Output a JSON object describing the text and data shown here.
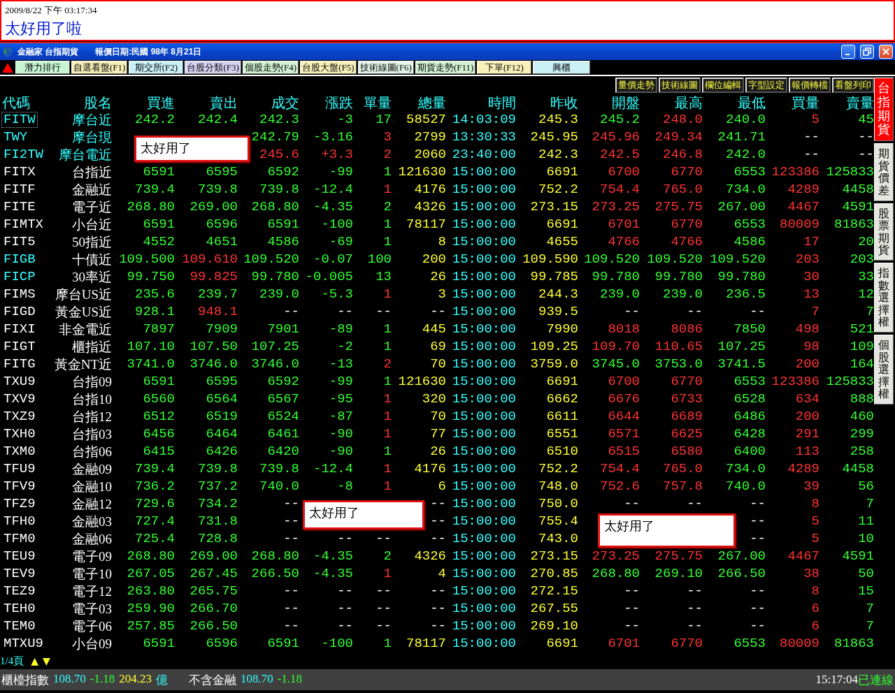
{
  "banner": {
    "timestamp": "2009/8/22 下午 03:17:34",
    "message": "太好用了啦"
  },
  "window": {
    "app_name": "金融家 台指期貨",
    "quote_date": "報價日期:民國 98年 8月21日"
  },
  "function_tabs": [
    {
      "label": "潛力排行",
      "color": "#c8f5d2"
    },
    {
      "label": "自選看盤(F1)",
      "color": "#f7f0b8"
    },
    {
      "label": "期交所(F2)",
      "color": "#c8f0f5"
    },
    {
      "label": "台股分類(F3)",
      "color": "#d8d2f2"
    },
    {
      "label": "個股走勢(F4)",
      "color": "#d2f2d2"
    },
    {
      "label": "台股大盤(F5)",
      "color": "#f7f0b8"
    },
    {
      "label": "技術線圖(F6)",
      "color": "#e2f5ea"
    },
    {
      "label": "期貨走勢(F11)",
      "color": "#d2f2d2"
    },
    {
      "label": "下單(F12)",
      "color": "#f7f0b8"
    },
    {
      "label": "興櫃",
      "color": "#c8f0f5"
    }
  ],
  "toolbar": [
    "量價走勢",
    "技術線圖",
    "欄位編輯",
    "字型設定",
    "報價轉檔",
    "看盤列印"
  ],
  "side_tabs": [
    {
      "label": "台指期貨",
      "selected": true
    },
    {
      "label": "期貨價差",
      "selected": false
    },
    {
      "label": "股票期貨",
      "selected": false
    },
    {
      "label": "指數選擇權",
      "selected": false
    },
    {
      "label": "個股選擇權",
      "selected": false
    }
  ],
  "table": {
    "columns": [
      {
        "label": "代碼"
      },
      {
        "label": "股名"
      },
      {
        "label": "買進"
      },
      {
        "label": "賣出"
      },
      {
        "label": "成交"
      },
      {
        "label": "漲跌"
      },
      {
        "label": "單量"
      },
      {
        "label": "總量",
        "color": "#ffff33"
      },
      {
        "label": "時間",
        "color": "#33ffff"
      },
      {
        "label": "昨收",
        "color": "#ffff33"
      },
      {
        "label": "開盤"
      },
      {
        "label": "最高"
      },
      {
        "label": "最低"
      },
      {
        "label": "買量",
        "color": "#ff3333"
      },
      {
        "label": "賣量",
        "color": "#33ff33"
      }
    ],
    "rows": [
      {
        "selected": true,
        "cells": [
          {
            "text": "FITW",
            "color": "#33ffff"
          },
          {
            "text": "摩台近",
            "color": "#33ffff"
          },
          {
            "text": "242.2",
            "color": "#33ff33"
          },
          {
            "text": "242.4",
            "color": "#33ff33"
          },
          {
            "text": "242.3",
            "color": "#33ff33"
          },
          {
            "text": "-3",
            "color": "#33ff33"
          },
          {
            "text": "17",
            "color": "#33ff33"
          },
          "58527",
          "14:03:09",
          "245.3",
          {
            "text": "245.2",
            "color": "#33ff33"
          },
          {
            "text": "248.0",
            "color": "#ff3333"
          },
          {
            "text": "240.0",
            "color": "#33ff33"
          },
          "5",
          "45"
        ]
      },
      {
        "selected": false,
        "cells": [
          {
            "text": "TWY",
            "color": "#33ffff"
          },
          {
            "text": "摩台現",
            "color": "#33ffff"
          },
          null,
          null,
          {
            "text": "242.79",
            "color": "#33ff33"
          },
          {
            "text": "-3.16",
            "color": "#33ff33"
          },
          {
            "text": "3",
            "color": "#ff3333"
          },
          "2799",
          "13:30:33",
          "245.95",
          {
            "text": "245.96",
            "color": "#ff3333"
          },
          {
            "text": "249.34",
            "color": "#ff3333"
          },
          {
            "text": "241.71",
            "color": "#33ff33"
          },
          {
            "text": "--",
            "color": "#ffffff"
          },
          {
            "text": "--",
            "color": "#ffffff"
          }
        ]
      },
      {
        "selected": false,
        "cells": [
          {
            "text": "FI2TW",
            "color": "#33ffff"
          },
          {
            "text": "摩台電近",
            "color": "#33ffff"
          },
          null,
          null,
          {
            "text": "245.6",
            "color": "#ff3333"
          },
          {
            "text": "+3.3",
            "color": "#ff3333"
          },
          {
            "text": "2",
            "color": "#ff3333"
          },
          "2060",
          "23:40:00",
          "242.3",
          {
            "text": "242.5",
            "color": "#ff3333"
          },
          {
            "text": "246.8",
            "color": "#ff3333"
          },
          {
            "text": "242.0",
            "color": "#33ff33"
          },
          {
            "text": "--",
            "color": "#ffffff"
          },
          {
            "text": "--",
            "color": "#ffffff"
          }
        ]
      },
      {
        "selected": false,
        "cells": [
          {
            "text": "FITX",
            "color": "#ffffff"
          },
          {
            "text": "台指近",
            "color": "#ffffff"
          },
          {
            "text": "6591",
            "color": "#33ff33"
          },
          {
            "text": "6595",
            "color": "#33ff33"
          },
          {
            "text": "6592",
            "color": "#33ff33"
          },
          {
            "text": "-99",
            "color": "#33ff33"
          },
          {
            "text": "1",
            "color": "#33ff33"
          },
          "121630",
          "15:00:00",
          "6691",
          {
            "text": "6700",
            "color": "#ff3333"
          },
          {
            "text": "6770",
            "color": "#ff3333"
          },
          {
            "text": "6553",
            "color": "#33ff33"
          },
          "123386",
          "125833"
        ]
      },
      {
        "selected": false,
        "cells": [
          {
            "text": "FITF",
            "color": "#ffffff"
          },
          {
            "text": "金融近",
            "color": "#ffffff"
          },
          {
            "text": "739.4",
            "color": "#33ff33"
          },
          {
            "text": "739.8",
            "color": "#33ff33"
          },
          {
            "text": "739.8",
            "color": "#33ff33"
          },
          {
            "text": "-12.4",
            "color": "#33ff33"
          },
          {
            "text": "1",
            "color": "#ff3333"
          },
          "4176",
          "15:00:00",
          "752.2",
          {
            "text": "754.4",
            "color": "#ff3333"
          },
          {
            "text": "765.0",
            "color": "#ff3333"
          },
          {
            "text": "734.0",
            "color": "#33ff33"
          },
          "4289",
          "4458"
        ]
      },
      {
        "selected": false,
        "cells": [
          {
            "text": "FITE",
            "color": "#ffffff"
          },
          {
            "text": "電子近",
            "color": "#ffffff"
          },
          {
            "text": "268.80",
            "color": "#33ff33"
          },
          {
            "text": "269.00",
            "color": "#33ff33"
          },
          {
            "text": "268.80",
            "color": "#33ff33"
          },
          {
            "text": "-4.35",
            "color": "#33ff33"
          },
          {
            "text": "2",
            "color": "#33ff33"
          },
          "4326",
          "15:00:00",
          "273.15",
          {
            "text": "273.25",
            "color": "#ff3333"
          },
          {
            "text": "275.75",
            "color": "#ff3333"
          },
          {
            "text": "267.00",
            "color": "#33ff33"
          },
          "4467",
          "4591"
        ]
      },
      {
        "selected": false,
        "cells": [
          {
            "text": "FIMTX",
            "color": "#ffffff"
          },
          {
            "text": "小台近",
            "color": "#ffffff"
          },
          {
            "text": "6591",
            "color": "#33ff33"
          },
          {
            "text": "6596",
            "color": "#33ff33"
          },
          {
            "text": "6591",
            "color": "#33ff33"
          },
          {
            "text": "-100",
            "color": "#33ff33"
          },
          {
            "text": "1",
            "color": "#33ff33"
          },
          "78117",
          "15:00:00",
          "6691",
          {
            "text": "6701",
            "color": "#ff3333"
          },
          {
            "text": "6770",
            "color": "#ff3333"
          },
          {
            "text": "6553",
            "color": "#33ff33"
          },
          "80009",
          "81863"
        ]
      },
      {
        "selected": false,
        "cells": [
          {
            "text": "FIT5",
            "color": "#ffffff"
          },
          {
            "text": "50指近",
            "color": "#ffffff"
          },
          {
            "text": "4552",
            "color": "#33ff33"
          },
          {
            "text": "4651",
            "color": "#33ff33"
          },
          {
            "text": "4586",
            "color": "#33ff33"
          },
          {
            "text": "-69",
            "color": "#33ff33"
          },
          {
            "text": "1",
            "color": "#33ff33"
          },
          "8",
          "15:00:00",
          "4655",
          {
            "text": "4766",
            "color": "#ff3333"
          },
          {
            "text": "4766",
            "color": "#ff3333"
          },
          {
            "text": "4586",
            "color": "#33ff33"
          },
          "17",
          "20"
        ]
      },
      {
        "selected": false,
        "cells": [
          {
            "text": "FIGB",
            "color": "#33ffff"
          },
          {
            "text": "十債近",
            "color": "#ffffff"
          },
          {
            "text": "109.500",
            "color": "#33ff33"
          },
          {
            "text": "109.610",
            "color": "#ff3333"
          },
          {
            "text": "109.520",
            "color": "#33ff33"
          },
          {
            "text": "-0.07",
            "color": "#33ff33"
          },
          {
            "text": "100",
            "color": "#33ff33"
          },
          "200",
          "15:00:00",
          "109.590",
          {
            "text": "109.520",
            "color": "#33ff33"
          },
          {
            "text": "109.520",
            "color": "#33ff33"
          },
          {
            "text": "109.520",
            "color": "#33ff33"
          },
          "203",
          "203"
        ]
      },
      {
        "selected": false,
        "cells": [
          {
            "text": "FICP",
            "color": "#33ffff"
          },
          {
            "text": "30率近",
            "color": "#ffffff"
          },
          {
            "text": "99.750",
            "color": "#33ff33"
          },
          {
            "text": "99.825",
            "color": "#ff3333"
          },
          {
            "text": "99.780",
            "color": "#33ff33"
          },
          {
            "text": "-0.005",
            "color": "#33ff33"
          },
          {
            "text": "13",
            "color": "#33ff33"
          },
          "26",
          "15:00:00",
          "99.785",
          {
            "text": "99.780",
            "color": "#33ff33"
          },
          {
            "text": "99.780",
            "color": "#33ff33"
          },
          {
            "text": "99.780",
            "color": "#33ff33"
          },
          "30",
          "33"
        ]
      },
      {
        "selected": false,
        "cells": [
          {
            "text": "FIMS",
            "color": "#ffffff"
          },
          {
            "text": "摩台US近",
            "color": "#ffffff"
          },
          {
            "text": "235.6",
            "color": "#33ff33"
          },
          {
            "text": "239.7",
            "color": "#33ff33"
          },
          {
            "text": "239.0",
            "color": "#33ff33"
          },
          {
            "text": "-5.3",
            "color": "#33ff33"
          },
          {
            "text": "1",
            "color": "#ff3333"
          },
          "3",
          "15:00:00",
          "244.3",
          {
            "text": "239.0",
            "color": "#33ff33"
          },
          {
            "text": "239.0",
            "color": "#33ff33"
          },
          {
            "text": "236.5",
            "color": "#33ff33"
          },
          "13",
          "12"
        ]
      },
      {
        "selected": false,
        "cells": [
          {
            "text": "FIGD",
            "color": "#ffffff"
          },
          {
            "text": "黃金US近",
            "color": "#ffffff"
          },
          {
            "text": "928.1",
            "color": "#33ff33"
          },
          {
            "text": "948.1",
            "color": "#ff3333"
          },
          {
            "text": "--",
            "color": "#ffffff"
          },
          {
            "text": "--",
            "color": "#ffffff"
          },
          {
            "text": "--",
            "color": "#ffffff"
          },
          {
            "text": "--",
            "color": "#ffffff"
          },
          "15:00:00",
          "939.5",
          {
            "text": "--",
            "color": "#ffffff"
          },
          {
            "text": "--",
            "color": "#ffffff"
          },
          {
            "text": "--",
            "color": "#ffffff"
          },
          "7",
          "7"
        ]
      },
      {
        "selected": false,
        "cells": [
          {
            "text": "FIXI",
            "color": "#ffffff"
          },
          {
            "text": "非金電近",
            "color": "#ffffff"
          },
          {
            "text": "7897",
            "color": "#33ff33"
          },
          {
            "text": "7909",
            "color": "#33ff33"
          },
          {
            "text": "7901",
            "color": "#33ff33"
          },
          {
            "text": "-89",
            "color": "#33ff33"
          },
          {
            "text": "1",
            "color": "#33ff33"
          },
          "445",
          "15:00:00",
          "7990",
          {
            "text": "8018",
            "color": "#ff3333"
          },
          {
            "text": "8086",
            "color": "#ff3333"
          },
          {
            "text": "7850",
            "color": "#33ff33"
          },
          "498",
          "521"
        ]
      },
      {
        "selected": false,
        "cells": [
          {
            "text": "FIGT",
            "color": "#ffffff"
          },
          {
            "text": "櫃指近",
            "color": "#ffffff"
          },
          {
            "text": "107.10",
            "color": "#33ff33"
          },
          {
            "text": "107.50",
            "color": "#33ff33"
          },
          {
            "text": "107.25",
            "color": "#33ff33"
          },
          {
            "text": "-2",
            "color": "#33ff33"
          },
          {
            "text": "1",
            "color": "#33ff33"
          },
          "69",
          "15:00:00",
          "109.25",
          {
            "text": "109.70",
            "color": "#ff3333"
          },
          {
            "text": "110.65",
            "color": "#ff3333"
          },
          {
            "text": "107.25",
            "color": "#33ff33"
          },
          "98",
          "109"
        ]
      },
      {
        "selected": false,
        "cells": [
          {
            "text": "FITG",
            "color": "#ffffff"
          },
          {
            "text": "黃金NT近",
            "color": "#ffffff"
          },
          {
            "text": "3741.0",
            "color": "#33ff33"
          },
          {
            "text": "3746.0",
            "color": "#33ff33"
          },
          {
            "text": "3746.0",
            "color": "#33ff33"
          },
          {
            "text": "-13",
            "color": "#33ff33"
          },
          {
            "text": "2",
            "color": "#ff3333"
          },
          "70",
          "15:00:00",
          "3759.0",
          {
            "text": "3745.0",
            "color": "#33ff33"
          },
          {
            "text": "3753.0",
            "color": "#33ff33"
          },
          {
            "text": "3741.5",
            "color": "#33ff33"
          },
          "200",
          "164"
        ]
      },
      {
        "selected": false,
        "cells": [
          {
            "text": "TXU9",
            "color": "#ffffff"
          },
          {
            "text": "台指09",
            "color": "#ffffff"
          },
          {
            "text": "6591",
            "color": "#33ff33"
          },
          {
            "text": "6595",
            "color": "#33ff33"
          },
          {
            "text": "6592",
            "color": "#33ff33"
          },
          {
            "text": "-99",
            "color": "#33ff33"
          },
          {
            "text": "1",
            "color": "#33ff33"
          },
          "121630",
          "15:00:00",
          "6691",
          {
            "text": "6700",
            "color": "#ff3333"
          },
          {
            "text": "6770",
            "color": "#ff3333"
          },
          {
            "text": "6553",
            "color": "#33ff33"
          },
          "123386",
          "125833"
        ]
      },
      {
        "selected": false,
        "cells": [
          {
            "text": "TXV9",
            "color": "#ffffff"
          },
          {
            "text": "台指10",
            "color": "#ffffff"
          },
          {
            "text": "6560",
            "color": "#33ff33"
          },
          {
            "text": "6564",
            "color": "#33ff33"
          },
          {
            "text": "6567",
            "color": "#33ff33"
          },
          {
            "text": "-95",
            "color": "#33ff33"
          },
          {
            "text": "1",
            "color": "#ff3333"
          },
          "320",
          "15:00:00",
          "6662",
          {
            "text": "6676",
            "color": "#ff3333"
          },
          {
            "text": "6733",
            "color": "#ff3333"
          },
          {
            "text": "6528",
            "color": "#33ff33"
          },
          "634",
          "888"
        ]
      },
      {
        "selected": false,
        "cells": [
          {
            "text": "TXZ9",
            "color": "#ffffff"
          },
          {
            "text": "台指12",
            "color": "#ffffff"
          },
          {
            "text": "6512",
            "color": "#33ff33"
          },
          {
            "text": "6519",
            "color": "#33ff33"
          },
          {
            "text": "6524",
            "color": "#33ff33"
          },
          {
            "text": "-87",
            "color": "#33ff33"
          },
          {
            "text": "1",
            "color": "#ff3333"
          },
          "70",
          "15:00:00",
          "6611",
          {
            "text": "6644",
            "color": "#ff3333"
          },
          {
            "text": "6689",
            "color": "#ff3333"
          },
          {
            "text": "6486",
            "color": "#33ff33"
          },
          "200",
          "460"
        ]
      },
      {
        "selected": false,
        "cells": [
          {
            "text": "TXH0",
            "color": "#ffffff"
          },
          {
            "text": "台指03",
            "color": "#ffffff"
          },
          {
            "text": "6456",
            "color": "#33ff33"
          },
          {
            "text": "6464",
            "color": "#33ff33"
          },
          {
            "text": "6461",
            "color": "#33ff33"
          },
          {
            "text": "-90",
            "color": "#33ff33"
          },
          {
            "text": "1",
            "color": "#ff3333"
          },
          "77",
          "15:00:00",
          "6551",
          {
            "text": "6571",
            "color": "#ff3333"
          },
          {
            "text": "6625",
            "color": "#ff3333"
          },
          {
            "text": "6428",
            "color": "#33ff33"
          },
          "291",
          "299"
        ]
      },
      {
        "selected": false,
        "cells": [
          {
            "text": "TXM0",
            "color": "#ffffff"
          },
          {
            "text": "台指06",
            "color": "#ffffff"
          },
          {
            "text": "6415",
            "color": "#33ff33"
          },
          {
            "text": "6426",
            "color": "#33ff33"
          },
          {
            "text": "6420",
            "color": "#33ff33"
          },
          {
            "text": "-90",
            "color": "#33ff33"
          },
          {
            "text": "1",
            "color": "#33ff33"
          },
          "26",
          "15:00:00",
          "6510",
          {
            "text": "6515",
            "color": "#ff3333"
          },
          {
            "text": "6580",
            "color": "#ff3333"
          },
          {
            "text": "6400",
            "color": "#33ff33"
          },
          "113",
          "258"
        ]
      },
      {
        "selected": false,
        "cells": [
          {
            "text": "TFU9",
            "color": "#ffffff"
          },
          {
            "text": "金融09",
            "color": "#ffffff"
          },
          {
            "text": "739.4",
            "color": "#33ff33"
          },
          {
            "text": "739.8",
            "color": "#33ff33"
          },
          {
            "text": "739.8",
            "color": "#33ff33"
          },
          {
            "text": "-12.4",
            "color": "#33ff33"
          },
          {
            "text": "1",
            "color": "#ff3333"
          },
          "4176",
          "15:00:00",
          "752.2",
          {
            "text": "754.4",
            "color": "#ff3333"
          },
          {
            "text": "765.0",
            "color": "#ff3333"
          },
          {
            "text": "734.0",
            "color": "#33ff33"
          },
          "4289",
          "4458"
        ]
      },
      {
        "selected": false,
        "cells": [
          {
            "text": "TFV9",
            "color": "#ffffff"
          },
          {
            "text": "金融10",
            "color": "#ffffff"
          },
          {
            "text": "736.2",
            "color": "#33ff33"
          },
          {
            "text": "737.2",
            "color": "#33ff33"
          },
          {
            "text": "740.0",
            "color": "#33ff33"
          },
          {
            "text": "-8",
            "color": "#33ff33"
          },
          {
            "text": "1",
            "color": "#ff3333"
          },
          "6",
          "15:00:00",
          "748.0",
          {
            "text": "752.6",
            "color": "#ff3333"
          },
          {
            "text": "757.8",
            "color": "#ff3333"
          },
          {
            "text": "740.0",
            "color": "#33ff33"
          },
          "39",
          "56"
        ]
      },
      {
        "selected": false,
        "cells": [
          {
            "text": "TFZ9",
            "color": "#ffffff"
          },
          {
            "text": "金融12",
            "color": "#ffffff"
          },
          {
            "text": "729.6",
            "color": "#33ff33"
          },
          {
            "text": "734.2",
            "color": "#33ff33"
          },
          {
            "text": "--",
            "color": "#ffffff"
          },
          null,
          null,
          {
            "text": "--",
            "color": "#ffffff"
          },
          "15:00:00",
          "750.0",
          {
            "text": "--",
            "color": "#ffffff"
          },
          {
            "text": "--",
            "color": "#ffffff"
          },
          {
            "text": "--",
            "color": "#ffffff"
          },
          "8",
          "7"
        ]
      },
      {
        "selected": false,
        "cells": [
          {
            "text": "TFH0",
            "color": "#ffffff"
          },
          {
            "text": "金融03",
            "color": "#ffffff"
          },
          {
            "text": "727.4",
            "color": "#33ff33"
          },
          {
            "text": "731.8",
            "color": "#33ff33"
          },
          {
            "text": "--",
            "color": "#ffffff"
          },
          null,
          null,
          {
            "text": "--",
            "color": "#ffffff"
          },
          "15:00:00",
          "755.4",
          null,
          null,
          {
            "text": "--",
            "color": "#ffffff"
          },
          "5",
          "11"
        ]
      },
      {
        "selected": false,
        "cells": [
          {
            "text": "TFM0",
            "color": "#ffffff"
          },
          {
            "text": "金融06",
            "color": "#ffffff"
          },
          {
            "text": "725.4",
            "color": "#33ff33"
          },
          {
            "text": "728.8",
            "color": "#33ff33"
          },
          {
            "text": "--",
            "color": "#ffffff"
          },
          {
            "text": "--",
            "color": "#ffffff"
          },
          {
            "text": "--",
            "color": "#ffffff"
          },
          {
            "text": "--",
            "color": "#ffffff"
          },
          "15:00:00",
          "743.0",
          null,
          null,
          {
            "text": "--",
            "color": "#ffffff"
          },
          "5",
          "10"
        ]
      },
      {
        "selected": false,
        "cells": [
          {
            "text": "TEU9",
            "color": "#ffffff"
          },
          {
            "text": "電子09",
            "color": "#ffffff"
          },
          {
            "text": "268.80",
            "color": "#33ff33"
          },
          {
            "text": "269.00",
            "color": "#33ff33"
          },
          {
            "text": "268.80",
            "color": "#33ff33"
          },
          {
            "text": "-4.35",
            "color": "#33ff33"
          },
          {
            "text": "2",
            "color": "#33ff33"
          },
          "4326",
          "15:00:00",
          "273.15",
          {
            "text": "273.25",
            "color": "#ff3333"
          },
          {
            "text": "275.75",
            "color": "#ff3333"
          },
          {
            "text": "267.00",
            "color": "#33ff33"
          },
          "4467",
          "4591"
        ]
      },
      {
        "selected": false,
        "cells": [
          {
            "text": "TEV9",
            "color": "#ffffff"
          },
          {
            "text": "電子10",
            "color": "#ffffff"
          },
          {
            "text": "267.05",
            "color": "#33ff33"
          },
          {
            "text": "267.45",
            "color": "#33ff33"
          },
          {
            "text": "266.50",
            "color": "#33ff33"
          },
          {
            "text": "-4.35",
            "color": "#33ff33"
          },
          {
            "text": "1",
            "color": "#ff3333"
          },
          "4",
          "15:00:00",
          "270.85",
          {
            "text": "268.80",
            "color": "#33ff33"
          },
          {
            "text": "269.10",
            "color": "#33ff33"
          },
          {
            "text": "266.50",
            "color": "#33ff33"
          },
          "38",
          "50"
        ]
      },
      {
        "selected": false,
        "cells": [
          {
            "text": "TEZ9",
            "color": "#ffffff"
          },
          {
            "text": "電子12",
            "color": "#ffffff"
          },
          {
            "text": "263.80",
            "color": "#33ff33"
          },
          {
            "text": "265.75",
            "color": "#33ff33"
          },
          {
            "text": "--",
            "color": "#ffffff"
          },
          {
            "text": "--",
            "color": "#ffffff"
          },
          {
            "text": "--",
            "color": "#ffffff"
          },
          {
            "text": "--",
            "color": "#ffffff"
          },
          "15:00:00",
          "272.15",
          {
            "text": "--",
            "color": "#ffffff"
          },
          {
            "text": "--",
            "color": "#ffffff"
          },
          {
            "text": "--",
            "color": "#ffffff"
          },
          "8",
          "15"
        ]
      },
      {
        "selected": false,
        "cells": [
          {
            "text": "TEH0",
            "color": "#ffffff"
          },
          {
            "text": "電子03",
            "color": "#ffffff"
          },
          {
            "text": "259.90",
            "color": "#33ff33"
          },
          {
            "text": "266.70",
            "color": "#33ff33"
          },
          {
            "text": "--",
            "color": "#ffffff"
          },
          {
            "text": "--",
            "color": "#ffffff"
          },
          {
            "text": "--",
            "color": "#ffffff"
          },
          {
            "text": "--",
            "color": "#ffffff"
          },
          "15:00:00",
          "267.55",
          {
            "text": "--",
            "color": "#ffffff"
          },
          {
            "text": "--",
            "color": "#ffffff"
          },
          {
            "text": "--",
            "color": "#ffffff"
          },
          "6",
          "7"
        ]
      },
      {
        "selected": false,
        "cells": [
          {
            "text": "TEM0",
            "color": "#ffffff"
          },
          {
            "text": "電子06",
            "color": "#ffffff"
          },
          {
            "text": "257.85",
            "color": "#33ff33"
          },
          {
            "text": "266.50",
            "color": "#33ff33"
          },
          {
            "text": "--",
            "color": "#ffffff"
          },
          {
            "text": "--",
            "color": "#ffffff"
          },
          {
            "text": "--",
            "color": "#ffffff"
          },
          {
            "text": "--",
            "color": "#ffffff"
          },
          "15:00:00",
          "269.10",
          {
            "text": "--",
            "color": "#ffffff"
          },
          {
            "text": "--",
            "color": "#ffffff"
          },
          {
            "text": "--",
            "color": "#ffffff"
          },
          "6",
          "7"
        ]
      },
      {
        "selected": false,
        "cells": [
          {
            "text": "MTXU9",
            "color": "#ffffff"
          },
          {
            "text": "小台09",
            "color": "#ffffff"
          },
          {
            "text": "6591",
            "color": "#33ff33"
          },
          {
            "text": "6596",
            "color": "#33ff33"
          },
          {
            "text": "6591",
            "color": "#33ff33"
          },
          {
            "text": "-100",
            "color": "#33ff33"
          },
          {
            "text": "1",
            "color": "#33ff33"
          },
          "78117",
          "15:00:00",
          "6691",
          {
            "text": "6701",
            "color": "#ff3333"
          },
          {
            "text": "6770",
            "color": "#ff3333"
          },
          {
            "text": "6553",
            "color": "#33ff33"
          },
          "80009",
          "81863"
        ]
      }
    ]
  },
  "callouts": [
    "太好用了",
    "太好用了",
    "太好用了"
  ],
  "pager": {
    "page": "1/4頁",
    "up": "▲",
    "down": "▼"
  },
  "status_bar": {
    "items": [
      {
        "text": "櫃檯指數",
        "color": "#ffffff"
      },
      {
        "text": "108.70",
        "color": "#33ffff"
      },
      {
        "text": "-1.18",
        "color": "#33ff33"
      },
      {
        "text": "204.23",
        "color": "#ffff33"
      },
      {
        "text": "億",
        "color": "#33ffff"
      },
      {
        "text": "不含金融",
        "color": "#ffffff"
      },
      {
        "text": "108.70",
        "color": "#33ffff"
      },
      {
        "text": "-1.18",
        "color": "#33ff33"
      }
    ],
    "time": "15:17:04",
    "connection": "已連線"
  }
}
